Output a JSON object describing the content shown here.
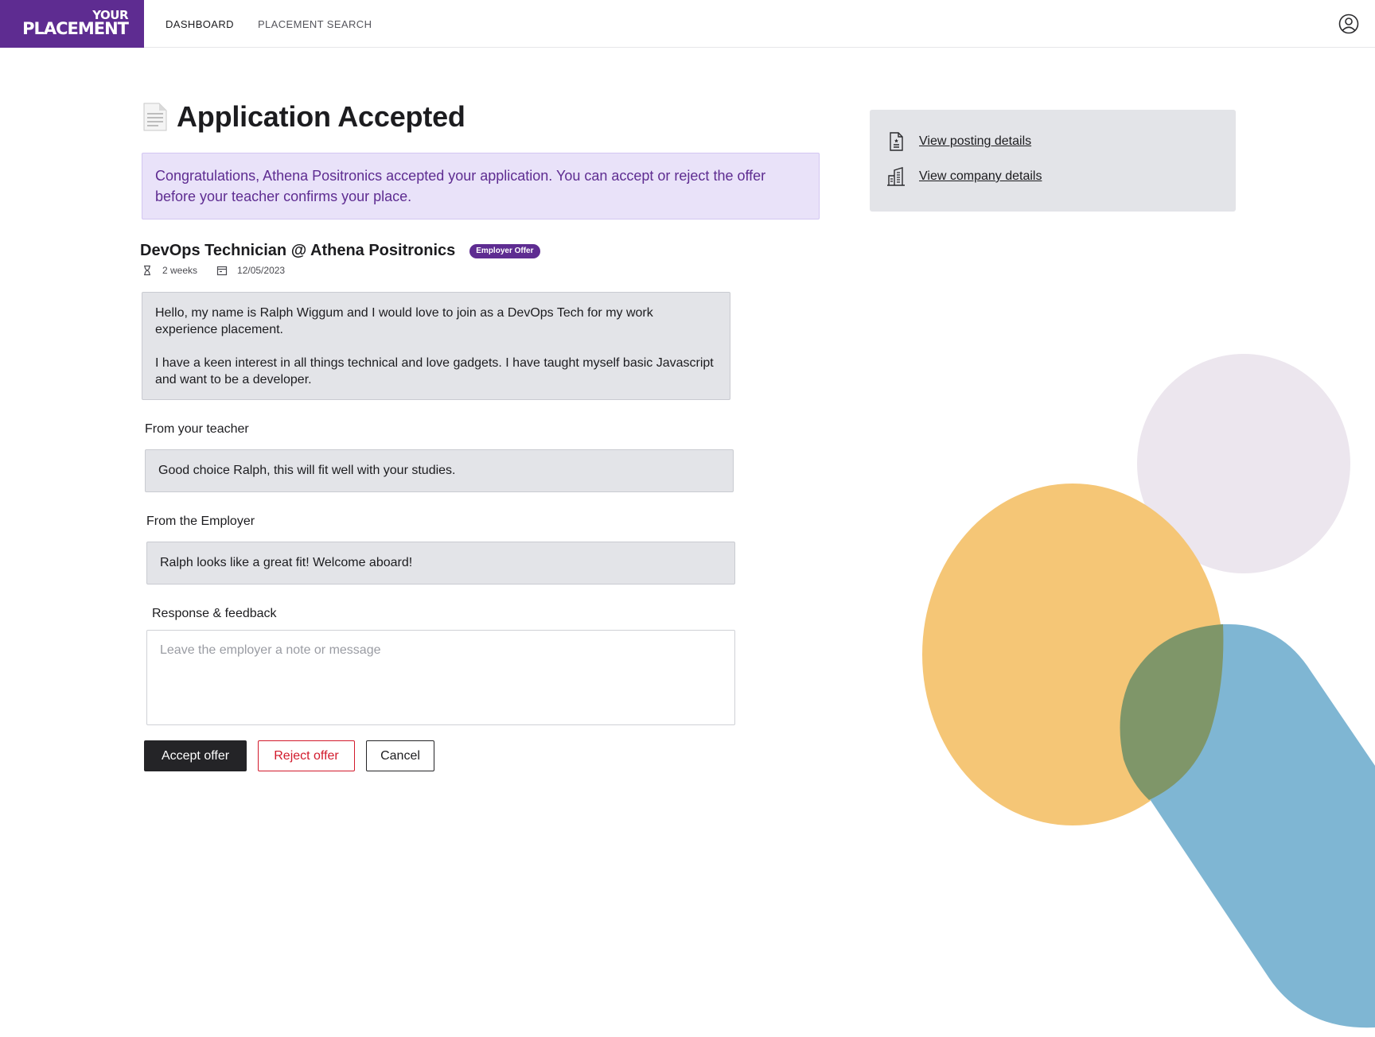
{
  "app": {
    "logo_top": "YOUR",
    "logo_bottom": "PLACEMENT"
  },
  "nav": {
    "items": [
      {
        "label": "DASHBOARD"
      },
      {
        "label": "PLACEMENT SEARCH"
      }
    ]
  },
  "page": {
    "title": "Application Accepted",
    "alert": "Congratulations, Athena Positronics accepted your application. You can accept or reject the offer before your teacher confirms your place."
  },
  "job": {
    "title": "DevOps Technician @ Athena Positronics",
    "badge": "Employer Offer",
    "duration": "2 weeks",
    "date": "12/05/2023"
  },
  "application": {
    "paragraphs": [
      "Hello, my name is Ralph Wiggum and I would love to join as a DevOps Tech for my work experience placement.",
      "I have a keen interest in all things technical and love gadgets. I have taught myself basic Javascript and want to be a developer."
    ]
  },
  "teacher": {
    "label": "From your teacher",
    "message": "Good choice Ralph, this will fit well with your studies."
  },
  "employer": {
    "label": "From the Employer",
    "message": "Ralph looks like a great fit! Welcome aboard!"
  },
  "response": {
    "label": "Response & feedback",
    "placeholder": "Leave the employer a note or message",
    "value": ""
  },
  "actions": {
    "accept": "Accept offer",
    "reject": "Reject offer",
    "cancel": "Cancel"
  },
  "side_links": [
    {
      "label": "View posting details",
      "icon": "document-icon"
    },
    {
      "label": "View company details",
      "icon": "building-icon"
    }
  ],
  "colors": {
    "brand": "#5e2c91",
    "alert_bg": "#e9e2f9",
    "reject": "#d21a2c",
    "deco_lavender": "#ece6ee",
    "deco_orange": "#f5c676",
    "deco_blue": "#7fb6d3",
    "deco_overlap": "#7f9669"
  }
}
